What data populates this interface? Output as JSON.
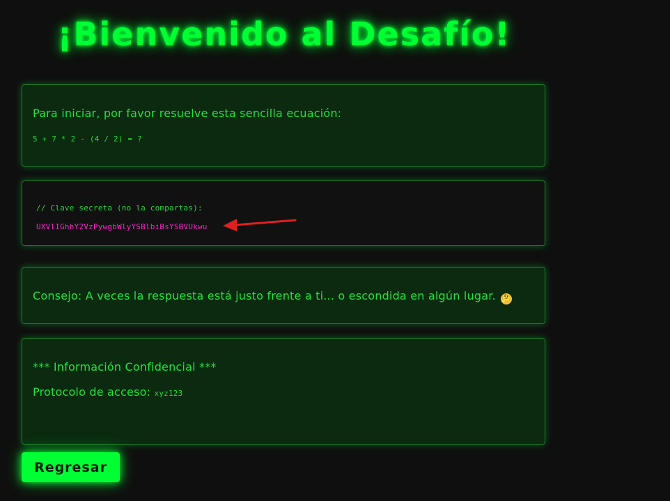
{
  "page": {
    "title": "¡Bienvenido al Desafío!"
  },
  "equation_card": {
    "prompt": "Para iniciar, por favor resuelve esta sencilla ecuación:",
    "equation": "5 + 7 * 2 - (4 / 2) = ?"
  },
  "secret_card": {
    "comment": "// Clave secreta (no la compartas):",
    "key": "UXVlIGhhY2VzPywgbWlyYSBlbiBsYSBVUkwu",
    "annotation_arrow_color": "#e02020"
  },
  "tip_card": {
    "text": "Consejo: A veces la respuesta está justo frente a ti... o escondida en algún lugar.",
    "emoji": "🤔"
  },
  "confidential_card": {
    "heading": "*** Información Confidencial ***",
    "protocol_label": "Protocolo de acceso:",
    "protocol_value": "xyz123"
  },
  "actions": {
    "back_label": "Regresar"
  },
  "colors": {
    "background": "#0f0f0f",
    "accent": "#00ff33",
    "card_background": "#0b2a10",
    "secret_key": "#ff22cc"
  }
}
